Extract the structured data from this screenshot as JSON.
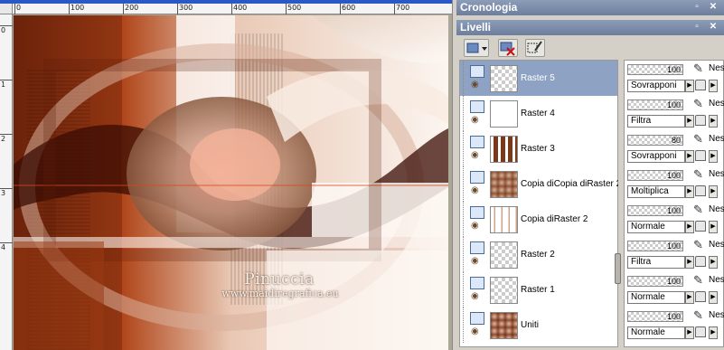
{
  "canvas": {
    "ruler_labels_h": [
      "0",
      "100",
      "200",
      "300",
      "400",
      "500",
      "600",
      "700"
    ],
    "ruler_labels_v": [
      "0",
      "1",
      "2",
      "3",
      "4"
    ],
    "signature": "Pinuccia",
    "website": "www.maidiregrafica.eu"
  },
  "cronologia": {
    "title": "Cronologia"
  },
  "livelli": {
    "title": "Livelli",
    "toolbar": [
      "new-layer-icon",
      "delete-layer-icon",
      "edit-mask-icon"
    ],
    "layers": [
      {
        "name": "Raster 5",
        "selected": true,
        "opacity": "100",
        "blend": "Sovrapponi",
        "extra": "Nes"
      },
      {
        "name": "Raster 4",
        "selected": false,
        "opacity": "100",
        "blend": "Filtra",
        "extra": "Nes"
      },
      {
        "name": "Raster 3",
        "selected": false,
        "opacity": "80",
        "blend": "Sovrapponi",
        "extra": "Nes"
      },
      {
        "name": "Copia diCopia diRaster 2",
        "selected": false,
        "opacity": "100",
        "blend": "Moltiplica",
        "extra": "Nes"
      },
      {
        "name": "Copia diRaster 2",
        "selected": false,
        "opacity": "100",
        "blend": "Normale",
        "extra": "Nes"
      },
      {
        "name": "Raster 2",
        "selected": false,
        "opacity": "100",
        "blend": "Filtra",
        "extra": "Nes"
      },
      {
        "name": "Raster 1",
        "selected": false,
        "opacity": "100",
        "blend": "Normale",
        "extra": "Nes"
      },
      {
        "name": "Uniti",
        "selected": false,
        "opacity": "100",
        "blend": "Normale",
        "extra": "Nes"
      }
    ]
  },
  "colors": {
    "accent": "#8ea3c4",
    "titlebar": "#6d7e9d",
    "brown": "#8a3a14"
  }
}
